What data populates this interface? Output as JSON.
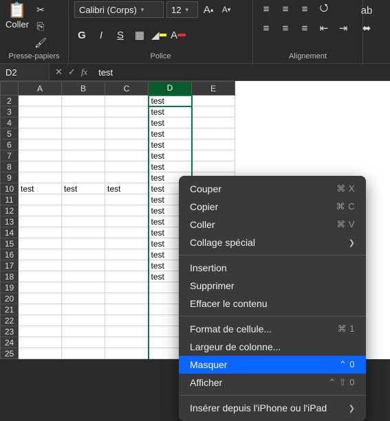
{
  "ribbon": {
    "paste_label": "Coller",
    "clip_group": "Presse-papiers",
    "font_group": "Police",
    "align_group": "Alignement",
    "font_name": "Calibri (Corps)",
    "font_size": "12",
    "bold": "G",
    "italic": "I",
    "underline": "S",
    "increase_font_glyph": "A",
    "decrease_font_glyph": "A",
    "font_color_glyph": "A"
  },
  "formula_bar": {
    "cell_ref": "D2",
    "cancel": "✕",
    "confirm": "✓",
    "fx": "fx",
    "value": "test"
  },
  "columns": [
    "A",
    "B",
    "C",
    "D",
    "E"
  ],
  "rows": [
    2,
    3,
    4,
    5,
    6,
    7,
    8,
    9,
    10,
    11,
    12,
    13,
    14,
    15,
    16,
    17,
    18,
    19,
    20,
    21,
    22,
    23,
    24,
    25
  ],
  "selected_column_index": 3,
  "active_row": 2,
  "cells": {
    "D2": "test",
    "D3": "test",
    "D4": "test",
    "D5": "test",
    "D6": "test",
    "D7": "test",
    "D8": "test",
    "D9": "test",
    "A10": "test",
    "B10": "test",
    "C10": "test",
    "D10": "test",
    "D11": "test",
    "D12": "test",
    "D13": "test",
    "D14": "test",
    "D15": "test",
    "D16": "test",
    "D17": "test",
    "D18": "test"
  },
  "context_menu": {
    "cut": {
      "label": "Couper",
      "shortcut": "⌘ X"
    },
    "copy": {
      "label": "Copier",
      "shortcut": "⌘ C"
    },
    "paste": {
      "label": "Coller",
      "shortcut": "⌘ V"
    },
    "paste_sp": {
      "label": "Collage spécial"
    },
    "insert": {
      "label": "Insertion"
    },
    "delete": {
      "label": "Supprimer"
    },
    "clear": {
      "label": "Effacer le contenu"
    },
    "format": {
      "label": "Format de cellule...",
      "shortcut": "⌘ 1"
    },
    "colwidth": {
      "label": "Largeur de colonne..."
    },
    "hide": {
      "label": "Masquer",
      "shortcut": "⌃ 0"
    },
    "show": {
      "label": "Afficher",
      "shortcut": "⌃ ⇧ 0"
    },
    "insert_dev": {
      "label": "Insérer depuis l'iPhone ou l'iPad"
    }
  }
}
